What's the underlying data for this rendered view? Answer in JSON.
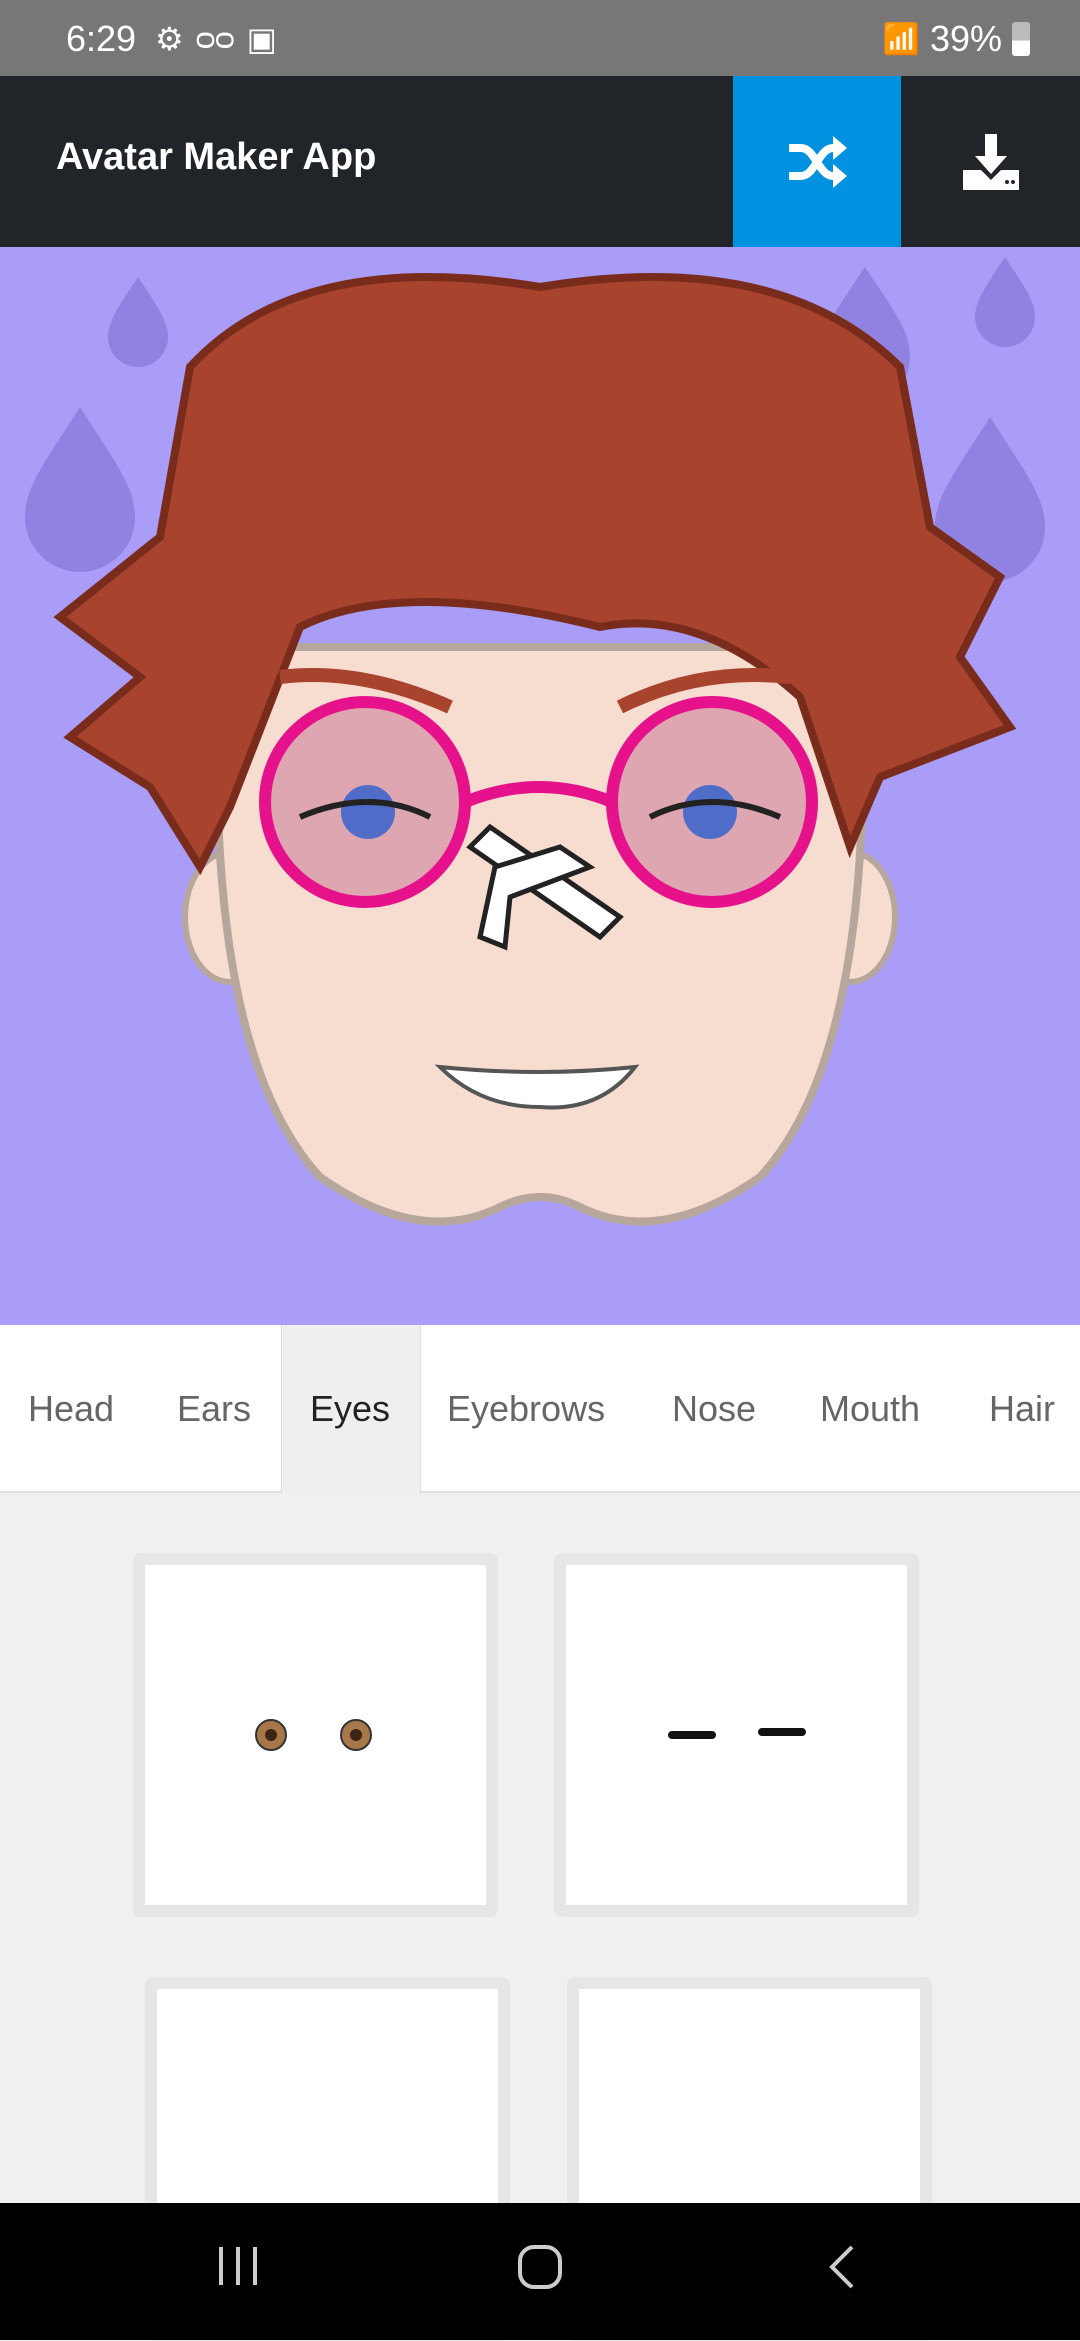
{
  "status_bar": {
    "time": "6:29",
    "battery": "39%",
    "icons": [
      "settings-icon",
      "voicemail-icon",
      "image-icon",
      "wifi-icon",
      "signal-icon",
      "battery-icon"
    ]
  },
  "header": {
    "title": "Avatar Maker App",
    "shuffle_icon": "shuffle-icon",
    "download_icon": "download-icon",
    "accent": "#0092e0"
  },
  "avatar": {
    "background": "#a99df7"
  },
  "tabs": [
    {
      "label": "Head"
    },
    {
      "label": "Ears"
    },
    {
      "label": "Eyes",
      "active": true
    },
    {
      "label": "Eyebrows"
    },
    {
      "label": "Nose"
    },
    {
      "label": "Mouth"
    },
    {
      "label": "Hair"
    }
  ],
  "options": [
    {
      "name": "eyes-option-1"
    },
    {
      "name": "eyes-option-2"
    },
    {
      "name": "eyes-option-3"
    },
    {
      "name": "eyes-option-4"
    }
  ],
  "nav": {
    "icons": [
      "recents-icon",
      "home-icon",
      "back-icon"
    ]
  }
}
